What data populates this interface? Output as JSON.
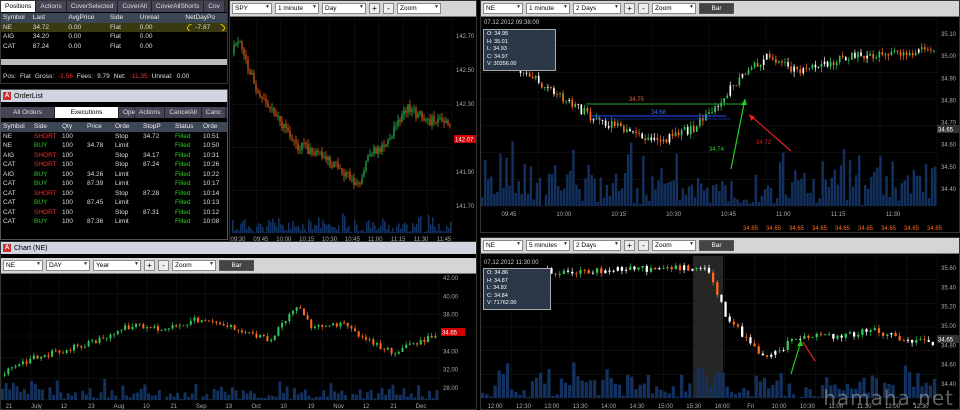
{
  "positions": {
    "tabs": [
      "Positions",
      "Actions",
      "CoverSelected",
      "CoverAll",
      "CoverAllShorts",
      "Cov"
    ],
    "columns": [
      "Symbol",
      "Last",
      "AvgPrice",
      "Side",
      "Unreal",
      "NetDayPo"
    ],
    "rows": [
      {
        "symbol": "NE",
        "last": "34.72",
        "avg": "0.00",
        "side": "Flat",
        "unreal": "0.00",
        "net": "-7.87"
      },
      {
        "symbol": "AIG",
        "last": "34.20",
        "avg": "0.00",
        "side": "Flat",
        "unreal": "0.00",
        "net": ""
      },
      {
        "symbol": "CAT",
        "last": "87.24",
        "avg": "0.00",
        "side": "Flat",
        "unreal": "0.00",
        "net": ""
      }
    ],
    "status": {
      "pos_label": "Pos:",
      "pos": "Flat",
      "gross_label": "Gross:",
      "gross": "-1.56",
      "fees_label": "Fees:",
      "fees": "9.79",
      "net_label": "Net:",
      "net": "-11.35",
      "unreal_label": "Unreal:",
      "unreal": "0.00"
    }
  },
  "orderlist": {
    "title": "OrderList",
    "tabs": [
      "All Orders",
      "Executions",
      "Ope",
      "Actions",
      "CancelAll",
      "Canc"
    ],
    "columns": [
      "Symbol",
      "Side",
      "Qty",
      "Price",
      "Orde",
      "StopP",
      "Status",
      "Orde"
    ],
    "rows": [
      {
        "symbol": "NE",
        "side": "SHORT",
        "qty": "100",
        "price": "",
        "type": "Stop",
        "stop": "34.72",
        "status": "Filled",
        "time": "10:51"
      },
      {
        "symbol": "NE",
        "side": "BUY",
        "qty": "100",
        "price": "34.78",
        "type": "Limit",
        "stop": "",
        "status": "Filled",
        "time": "10:50"
      },
      {
        "symbol": "AIG",
        "side": "SHORT",
        "qty": "100",
        "price": "",
        "type": "Stop",
        "stop": "34.17",
        "status": "Filled",
        "time": "10:31"
      },
      {
        "symbol": "CAT",
        "side": "SHORT",
        "qty": "100",
        "price": "",
        "type": "Stop",
        "stop": "87.24",
        "status": "Filled",
        "time": "10:26"
      },
      {
        "symbol": "AIG",
        "side": "BUY",
        "qty": "100",
        "price": "34.26",
        "type": "Limit",
        "stop": "",
        "status": "Filled",
        "time": "10:22"
      },
      {
        "symbol": "CAT",
        "side": "BUY",
        "qty": "100",
        "price": "87.39",
        "type": "Limit",
        "stop": "",
        "status": "Filled",
        "time": "10:17"
      },
      {
        "symbol": "CAT",
        "side": "SHORT",
        "qty": "100",
        "price": "",
        "type": "Stop",
        "stop": "87.28",
        "status": "Filled",
        "time": "10:14"
      },
      {
        "symbol": "CAT",
        "side": "BUY",
        "qty": "100",
        "price": "87.45",
        "type": "Limit",
        "stop": "",
        "status": "Filled",
        "time": "10:13"
      },
      {
        "symbol": "CAT",
        "side": "SHORT",
        "qty": "100",
        "price": "",
        "type": "Stop",
        "stop": "87.31",
        "status": "Filled",
        "time": "10:12"
      },
      {
        "symbol": "CAT",
        "side": "BUY",
        "qty": "100",
        "price": "87.36",
        "type": "Limit",
        "stop": "",
        "status": "Filled",
        "time": "10:08"
      }
    ]
  },
  "spy_chart": {
    "symbol": "SPY",
    "interval": "1 minute",
    "range": "Day",
    "zoom": "Zoom",
    "y_labels": [
      "142.70",
      "142.50",
      "142.30",
      "142.10",
      "141.90",
      "141.70"
    ],
    "x_labels": [
      "09:30",
      "09:45",
      "10:00",
      "10:15",
      "10:30",
      "10:45",
      "11:00",
      "11:15",
      "11:30",
      "11:45"
    ],
    "last_price": "142.07"
  },
  "ne_1min_chart": {
    "symbol": "NE",
    "interval": "1 minute",
    "range": "2 Days",
    "zoom": "Zoom",
    "bar": "Bar",
    "ohlc": {
      "stamp": "07.12.2012 09:38:00",
      "o": "O: 34.95",
      "h": "H: 35.01",
      "l": "L: 34.93",
      "c": "C: 34.97",
      "v": "V: 30356.00"
    },
    "y_labels": [
      "35.10",
      "35.00",
      "34.90",
      "34.80",
      "34.70",
      "34.60",
      "34.50",
      "34.40"
    ],
    "x_labels": [
      "09:45",
      "10:00",
      "10:15",
      "10:30",
      "10:45",
      "11:00",
      "11:15",
      "11:30"
    ],
    "last_price": "34.65",
    "annotations": {
      "level_green": "34.75",
      "level_blue": "34.68",
      "entry": "34.74",
      "exit": "34.72"
    },
    "bottom_prices": [
      "34.65",
      "34.65",
      "34.65",
      "34.65",
      "34.65",
      "34.65",
      "34.65",
      "34.65",
      "34.65"
    ]
  },
  "ne_daily_chart": {
    "window_title": "Chart (NE)",
    "symbol": "NE",
    "interval": "DAY",
    "range": "Year",
    "zoom": "Zoom",
    "bar": "Bar",
    "y_labels": [
      "42.00",
      "40.00",
      "38.00",
      "36.00",
      "34.00",
      "32.00",
      "28.00"
    ],
    "x_labels": [
      "21",
      "July",
      "12",
      "23",
      "Aug",
      "10",
      "21",
      "Sep",
      "13",
      "Oct",
      "10",
      "19",
      "Nov",
      "12",
      "21",
      "Dec"
    ],
    "last_price": "34.65"
  },
  "ne_5min_chart": {
    "symbol": "NE",
    "interval": "5 minutes",
    "range": "2 Days",
    "zoom": "Zoom",
    "bar": "Bar",
    "ohlc": {
      "stamp": "07.12.2012 11:30:00",
      "o": "O: 34.86",
      "h": "H: 34.87",
      "l": "L: 34.82",
      "c": "C: 34.84",
      "v": "V: 71762.00"
    },
    "y_labels": [
      "35.60",
      "35.40",
      "35.20",
      "35.00",
      "34.80",
      "34.60",
      "34.40"
    ],
    "x_labels": [
      "12:00",
      "12:30",
      "13:00",
      "13:30",
      "14:00",
      "14:30",
      "15:00",
      "15:30",
      "16:00",
      "Fri",
      "10:00",
      "10:30",
      "11:00",
      "11:30",
      "12:00",
      "12:30"
    ],
    "last_price": "34.65"
  },
  "watermark": "hamaha.net",
  "colors": {
    "up": "#34c85a",
    "down": "#ff6a1a",
    "volume": "#13315e",
    "panel_bg": "#000000",
    "toolbar": "#d5d5d5"
  }
}
